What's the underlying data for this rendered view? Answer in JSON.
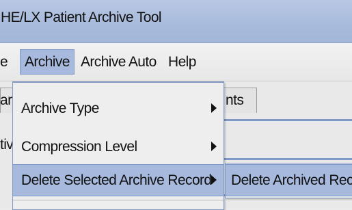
{
  "window": {
    "title": "HE/LX Patient Archive Tool"
  },
  "menubar": {
    "partial_left": "e",
    "items": [
      "Archive",
      "Archive Auto",
      "Help"
    ]
  },
  "tabs": {
    "left_partial": "аrс",
    "right_partial": "nts"
  },
  "content": {
    "left_partial_row1": "tiv"
  },
  "archive_menu": {
    "items": [
      {
        "label": "Archive Type",
        "submenu": true
      },
      {
        "label": "Compression Level",
        "submenu": true
      },
      {
        "label": "Delete Selected Archive Record",
        "submenu": true,
        "selected": true
      }
    ]
  },
  "submenu": {
    "items": [
      "Delete Archived Rec"
    ]
  },
  "colors": {
    "selection": "#a7badd",
    "border_accent": "#7f98c6",
    "title_bar": "#a9bbdc"
  },
  "icons": {
    "submenu_arrow": "right-arrow-icon"
  }
}
